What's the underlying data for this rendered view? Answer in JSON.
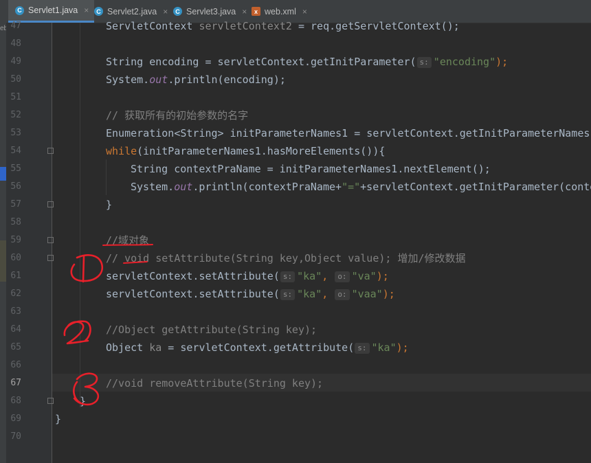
{
  "tabs": [
    {
      "label": "Servlet1.java",
      "icon": "java-class-icon",
      "active": true
    },
    {
      "label": "Servlet2.java",
      "icon": "java-class-icon",
      "active": false
    },
    {
      "label": "Servlet3.java",
      "icon": "java-class-icon",
      "active": false
    },
    {
      "label": "web.xml",
      "icon": "xml-file-icon",
      "active": false
    }
  ],
  "tab_close_glyph": "×",
  "left_strip_text": "eb",
  "line_numbers": [
    "47",
    "48",
    "49",
    "50",
    "51",
    "52",
    "53",
    "54",
    "55",
    "56",
    "57",
    "58",
    "59",
    "60",
    "61",
    "62",
    "63",
    "64",
    "65",
    "66",
    "67",
    "68",
    "69",
    "70"
  ],
  "current_line": "67",
  "code": {
    "l47": {
      "a": "ServletContext ",
      "b": "servletContext2",
      "c": " = req.getServletContext();"
    },
    "l49": {
      "a": "String encoding = servletContext.getInitParameter(",
      "hint": "s:",
      "str": "\"encoding\"",
      "c": ");"
    },
    "l50": {
      "a": "System.",
      "out": "out",
      "c": ".println(encoding);"
    },
    "l52": "// 获取所有的初始参数的名字",
    "l53": "Enumeration<String> initParameterNames1 = servletContext.getInitParameterNames(",
    "l54": {
      "kw": "while",
      "c": "(initParameterNames1.hasMoreElements()){"
    },
    "l55": "String contextPraName = initParameterNames1.nextElement();",
    "l56": {
      "a": "System.",
      "out": "out",
      "b": ".println(contextPraName+",
      "str": "\"=\"",
      "c": "+servletContext.getInitParameter(conte"
    },
    "l57": "}",
    "l59": "//域对象",
    "l60": "// void setAttribute(String key,Object value); 增加/修改数据",
    "l61": {
      "a": "servletContext.setAttribute(",
      "h1": "s:",
      "s1": "\"ka\"",
      "h2": "o:",
      "s2": "\"va\"",
      "c": ");"
    },
    "l62": {
      "a": "servletContext.setAttribute(",
      "h1": "s:",
      "s1": "\"ka\"",
      "h2": "o:",
      "s2": "\"vaa\"",
      "c": ");"
    },
    "l64": "//Object getAttribute(String key);",
    "l65": {
      "a": "Object ",
      "b": "ka",
      "c": " = servletContext.getAttribute(",
      "hint": "s:",
      "str": "\"ka\"",
      "d": ");"
    },
    "l67": "//void removeAttribute(String key);",
    "l68": "}",
    "l69": "}"
  },
  "annotation_color": "#e8202a"
}
